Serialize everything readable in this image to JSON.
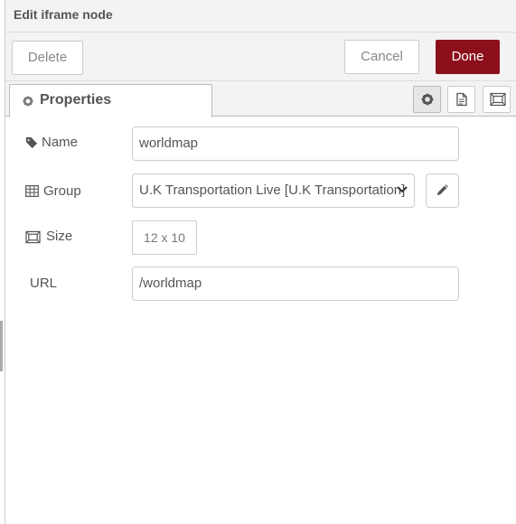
{
  "header": {
    "title": "Edit iframe node"
  },
  "toolbar": {
    "delete_label": "Delete",
    "cancel_label": "Cancel",
    "done_label": "Done"
  },
  "tabs": [
    {
      "label": "Properties",
      "icon": "gear-icon"
    }
  ],
  "tab_buttons": [
    {
      "icon": "gear-icon",
      "selected": true
    },
    {
      "icon": "document-icon",
      "selected": false
    },
    {
      "icon": "node-appearance-icon",
      "selected": false
    }
  ],
  "form": {
    "name": {
      "label": "Name",
      "icon": "tag-icon",
      "value": "worldmap"
    },
    "group": {
      "label": "Group",
      "icon": "table-icon",
      "value": "U.K Transportation Live [U.K Transportation]"
    },
    "size": {
      "label": "Size",
      "icon": "size-icon",
      "value": "12 x 10"
    },
    "url": {
      "label": "URL",
      "value": "/worldmap"
    }
  },
  "colors": {
    "done_button": "#8c101c",
    "header_bg": "#f3f3f3"
  }
}
